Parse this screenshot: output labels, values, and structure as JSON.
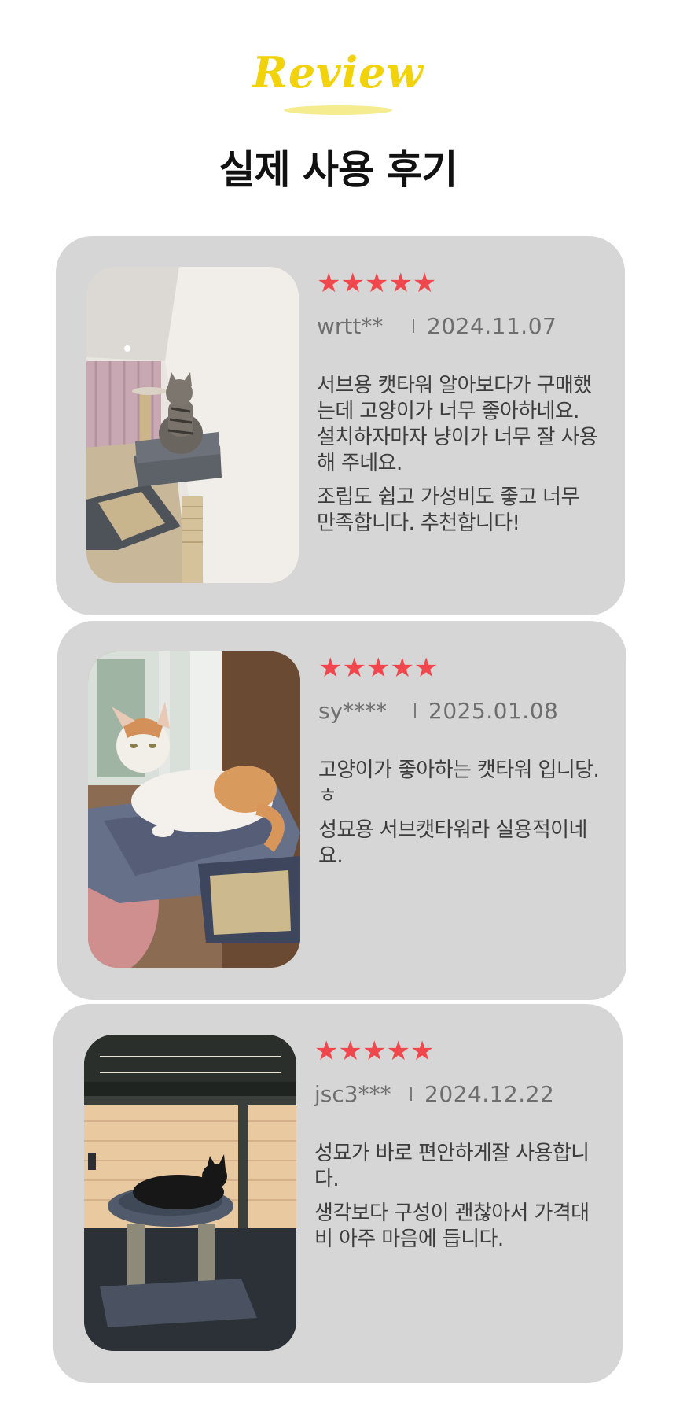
{
  "header": {
    "eyebrow": "Review",
    "title": "실제 사용 후기",
    "accent_color": "#f2d20a"
  },
  "reviews": [
    {
      "rating": 5,
      "stars": "★★★★★",
      "user": "wrtt**",
      "date": "2024.11.07",
      "paragraphs": [
        "서브용 캣타워 알아보다가 구매했는데 고양이가 너무 좋아하네요. 설치하자마자 냥이가 너무 잘 사용해 주네요.",
        "조립도 쉽고 가성비도 좋고 너무 만족합니다. 추천합니다!"
      ],
      "photo": "tabby-cat-on-cat-tower-photo"
    },
    {
      "rating": 5,
      "stars": "★★★★★",
      "user": "sy****",
      "date": "2025.01.08",
      "paragraphs": [
        "고양이가 좋아하는 캣타워 입니당.ㅎ",
        "성묘용 서브캣타워라 실용적이네요."
      ],
      "photo": "orange-white-cat-lying-on-cat-tower-photo"
    },
    {
      "rating": 5,
      "stars": "★★★★★",
      "user": "jsc3***",
      "date": "2024.12.22",
      "paragraphs": [
        "성묘가 바로 편안하게잘 사용합니다.",
        "생각보다 구성이 괜찮아서 가격대비 아주 마음에 듭니다."
      ],
      "photo": "dark-cat-silhouette-on-cat-tower-photo"
    }
  ],
  "colors": {
    "card_bg": "#d6d6d6",
    "star": "#f0474d",
    "meta_text": "#6e6e6e",
    "body_text": "#3d3d3d"
  }
}
